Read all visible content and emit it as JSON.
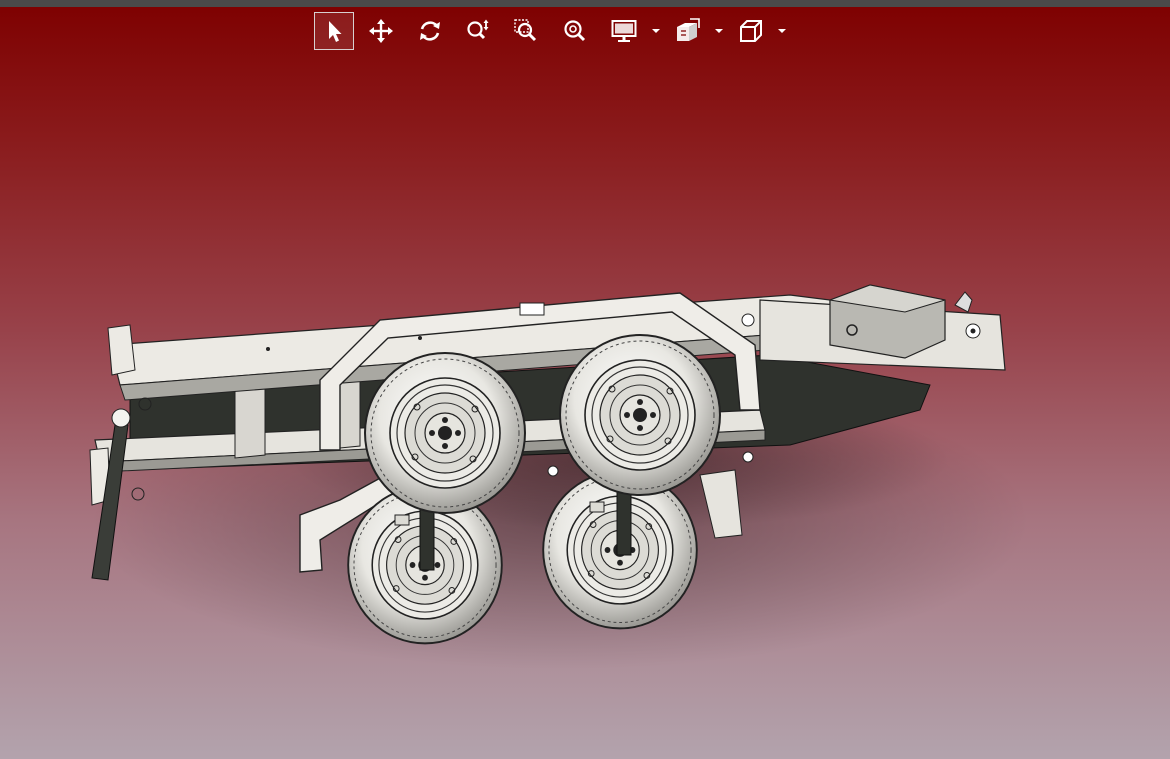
{
  "window": {
    "top_strip_color": "#4a4a4a"
  },
  "toolbar": {
    "tools": [
      {
        "name": "select-tool",
        "icon": "cursor-arrow-icon",
        "active": true
      },
      {
        "name": "pan-tool",
        "icon": "move-arrows-icon",
        "active": false
      },
      {
        "name": "rotate-tool",
        "icon": "rotate-icon",
        "active": false
      },
      {
        "name": "zoom-in-out-tool",
        "icon": "zoom-in-out-icon",
        "active": false
      },
      {
        "name": "zoom-area-tool",
        "icon": "zoom-area-icon",
        "active": false
      },
      {
        "name": "zoom-fit-tool",
        "icon": "zoom-fit-icon",
        "active": false
      },
      {
        "name": "display-style-menu",
        "icon": "monitor-icon",
        "has_dropdown": true
      },
      {
        "name": "section-view-menu",
        "icon": "section-view-icon",
        "has_dropdown": true
      },
      {
        "name": "view-orientation-menu",
        "icon": "cube-icon",
        "has_dropdown": true
      }
    ],
    "icon_color": "#ffffff"
  },
  "viewport": {
    "background_top": "#7e0000",
    "background_bottom": "#b3a3ad",
    "model": "trailer-chassis-assembly",
    "model_color": "#e6e4de",
    "dark_part_color": "#2f322d"
  }
}
